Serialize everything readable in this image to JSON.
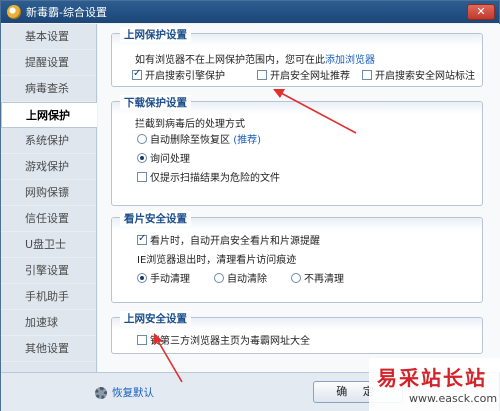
{
  "window": {
    "title": "新毒霸-综合设置",
    "close_label": "✕"
  },
  "sidebar": {
    "items": [
      {
        "label": "基本设置",
        "active": false
      },
      {
        "label": "提醒设置",
        "active": false
      },
      {
        "label": "病毒查杀",
        "active": false
      },
      {
        "label": "上网保护",
        "active": true
      },
      {
        "label": "系统保护",
        "active": false
      },
      {
        "label": "游戏保护",
        "active": false
      },
      {
        "label": "网购保镖",
        "active": false
      },
      {
        "label": "信任设置",
        "active": false
      },
      {
        "label": "U盘卫士",
        "active": false
      },
      {
        "label": "引擎设置",
        "active": false
      },
      {
        "label": "手机助手",
        "active": false
      },
      {
        "label": "加速球",
        "active": false
      },
      {
        "label": "其他设置",
        "active": false
      }
    ]
  },
  "web_protection": {
    "title": "上网保护设置",
    "desc": "如有浏览器不在上网保护范围内，您可在此",
    "add_link": "添加浏览器",
    "opt_search_engine": {
      "label": "开启搜索引擎保护",
      "checked": true
    },
    "opt_safe_url": {
      "label": "开启安全网址推荐",
      "checked": false
    },
    "opt_safe_site_mark": {
      "label": "开启搜索安全网站标注",
      "checked": false
    }
  },
  "download_protection": {
    "title": "下载保护设置",
    "desc": "拦截到病毒后的处理方式",
    "opt_auto_delete": {
      "label": "自动删除至恢复区",
      "hint": "(推荐)",
      "checked": false
    },
    "opt_ask": {
      "label": "询问处理",
      "checked": true
    },
    "opt_only_danger": {
      "label": "仅提示扫描结果为危险的文件",
      "checked": false
    }
  },
  "video_security": {
    "title": "看片安全设置",
    "opt_auto_safe": {
      "label": "看片时，自动开启安全看片和片源提醒",
      "checked": true
    },
    "ie_desc": "IE浏览器退出时，清理看片访问痕迹",
    "opt_manual": {
      "label": "手动清理",
      "checked": true
    },
    "opt_auto_clear": {
      "label": "自动清除",
      "checked": false
    },
    "opt_no_clear": {
      "label": "不再清理",
      "checked": false
    }
  },
  "web_security": {
    "title": "上网安全设置",
    "opt_lock_homepage": {
      "label": "锁第三方浏览器主页为毒霸网址大全",
      "checked": false
    }
  },
  "footer": {
    "restore_label": "恢复默认",
    "ok_label": "确 定"
  },
  "watermark": {
    "cn": "易采站长站",
    "url": "www.easck.com"
  },
  "colors": {
    "accent": "#1d4f8c",
    "link": "#1a5fbd",
    "arrow": "#e03030",
    "watermark": "#d2242a"
  }
}
